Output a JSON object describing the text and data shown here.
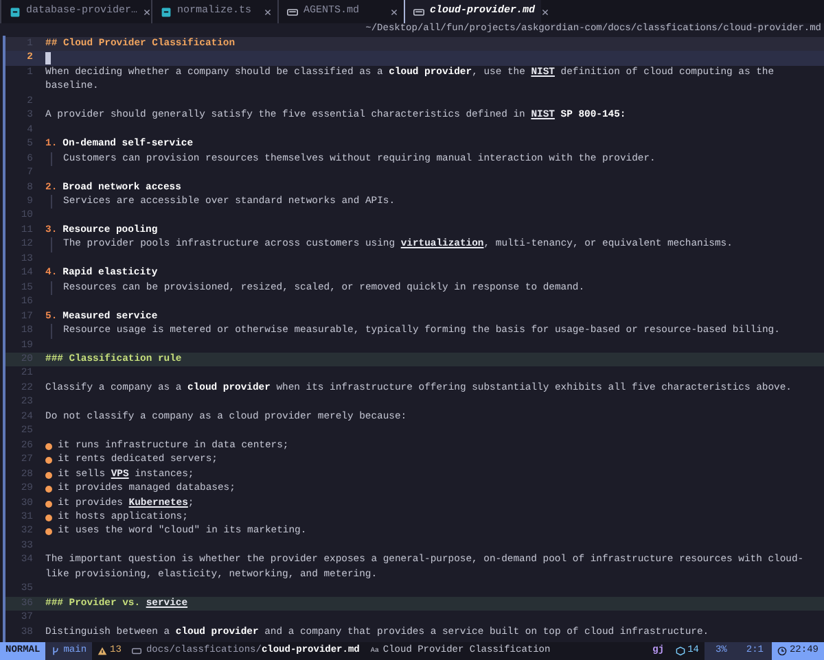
{
  "tabs": [
    {
      "label": "database-provider…",
      "kind": "script",
      "selected": false
    },
    {
      "label": "normalize.ts",
      "kind": "script",
      "selected": false
    },
    {
      "label": "AGENTS.md",
      "kind": "markdown",
      "selected": false
    },
    {
      "label": "cloud-provider.md",
      "kind": "markdown",
      "selected": true
    }
  ],
  "path": "~/Desktop/all/fun/projects/askgordian-com/docs/classfications/cloud-provider.md",
  "lines": [
    {
      "number": "1",
      "kind": "h2",
      "segments": [
        {
          "text": "## Cloud Provider Classification"
        }
      ]
    },
    {
      "number": "2",
      "kind": "cursor"
    },
    {
      "number": "1",
      "kind": "text",
      "segments": [
        {
          "text": "When deciding whether a company should be classified as a "
        },
        {
          "text": "cloud provider",
          "kind": "bold"
        },
        {
          "text": ", use the "
        },
        {
          "text": "NIST",
          "kind": "link"
        },
        {
          "text": " definition of cloud computing as the baseline."
        }
      ]
    },
    {
      "number": "2",
      "kind": "blank"
    },
    {
      "number": "3",
      "kind": "text",
      "segments": [
        {
          "text": "A provider should generally satisfy the five essential characteristics defined in "
        },
        {
          "text": "NIST",
          "kind": "link"
        },
        {
          "text": " SP 800-145:",
          "kind": "bold"
        }
      ]
    },
    {
      "number": "4",
      "kind": "blank"
    },
    {
      "number": "5",
      "kind": "numbered",
      "marker": "1.",
      "segments": [
        {
          "text": "On-demand self-service"
        }
      ]
    },
    {
      "number": "6",
      "kind": "detail",
      "segments": [
        {
          "text": "Customers can provision resources themselves without requiring manual interaction with the provider."
        }
      ]
    },
    {
      "number": "7",
      "kind": "blank"
    },
    {
      "number": "8",
      "kind": "numbered",
      "marker": "2.",
      "segments": [
        {
          "text": "Broad network access"
        }
      ]
    },
    {
      "number": "9",
      "kind": "detail",
      "segments": [
        {
          "text": "Services are accessible over standard networks and APIs."
        }
      ]
    },
    {
      "number": "10",
      "kind": "blank"
    },
    {
      "number": "11",
      "kind": "numbered",
      "marker": "3.",
      "segments": [
        {
          "text": "Resource pooling"
        }
      ]
    },
    {
      "number": "12",
      "kind": "detail",
      "segments": [
        {
          "text": "The provider pools infrastructure across customers using "
        },
        {
          "text": "virtualization",
          "kind": "link"
        },
        {
          "text": ", multi-tenancy, or equivalent mechanisms."
        }
      ]
    },
    {
      "number": "13",
      "kind": "blank"
    },
    {
      "number": "14",
      "kind": "numbered",
      "marker": "4.",
      "segments": [
        {
          "text": "Rapid elasticity"
        }
      ]
    },
    {
      "number": "15",
      "kind": "detail",
      "segments": [
        {
          "text": "Resources can be provisioned, resized, scaled, or removed quickly in response to demand."
        }
      ]
    },
    {
      "number": "16",
      "kind": "blank"
    },
    {
      "number": "17",
      "kind": "numbered",
      "marker": "5.",
      "segments": [
        {
          "text": "Measured service"
        }
      ]
    },
    {
      "number": "18",
      "kind": "detail",
      "segments": [
        {
          "text": "Resource usage is metered or otherwise measurable, typically forming the basis for usage-based or resource-based billing."
        }
      ]
    },
    {
      "number": "19",
      "kind": "blank"
    },
    {
      "number": "20",
      "kind": "h3",
      "segments": [
        {
          "text": "### Classification rule"
        }
      ]
    },
    {
      "number": "21",
      "kind": "blank"
    },
    {
      "number": "22",
      "kind": "text",
      "segments": [
        {
          "text": "Classify a company as a "
        },
        {
          "text": "cloud provider",
          "kind": "bold"
        },
        {
          "text": " when its infrastructure offering substantially exhibits all five characteristics above."
        }
      ]
    },
    {
      "number": "23",
      "kind": "blank"
    },
    {
      "number": "24",
      "kind": "text",
      "segments": [
        {
          "text": "Do not classify a company as a cloud provider merely because:"
        }
      ]
    },
    {
      "number": "25",
      "kind": "blank"
    },
    {
      "number": "26",
      "kind": "bullet",
      "segments": [
        {
          "text": "it runs infrastructure in data centers;"
        }
      ]
    },
    {
      "number": "27",
      "kind": "bullet",
      "segments": [
        {
          "text": "it rents dedicated servers;"
        }
      ]
    },
    {
      "number": "28",
      "kind": "bullet",
      "segments": [
        {
          "text": "it sells "
        },
        {
          "text": "VPS",
          "kind": "link"
        },
        {
          "text": " instances;"
        }
      ]
    },
    {
      "number": "29",
      "kind": "bullet",
      "segments": [
        {
          "text": "it provides managed databases;"
        }
      ]
    },
    {
      "number": "30",
      "kind": "bullet",
      "segments": [
        {
          "text": "it provides "
        },
        {
          "text": "Kubernetes",
          "kind": "link"
        },
        {
          "text": ";"
        }
      ]
    },
    {
      "number": "31",
      "kind": "bullet",
      "segments": [
        {
          "text": "it hosts applications;"
        }
      ]
    },
    {
      "number": "32",
      "kind": "bullet",
      "segments": [
        {
          "text": "it uses the word \"cloud\" in its marketing."
        }
      ]
    },
    {
      "number": "33",
      "kind": "blank"
    },
    {
      "number": "34",
      "kind": "text",
      "segments": [
        {
          "text": "The important question is whether the provider exposes a general-purpose, on-demand pool of infrastructure resources with cloud-like provisioning, elasticity, networking, and metering."
        }
      ]
    },
    {
      "number": "35",
      "kind": "blank"
    },
    {
      "number": "36",
      "kind": "h3",
      "segments": [
        {
          "text": "### Provider vs. "
        },
        {
          "text": "service",
          "kind": "link"
        }
      ]
    },
    {
      "number": "37",
      "kind": "blank"
    },
    {
      "number": "38",
      "kind": "text",
      "segments": [
        {
          "text": "Distinguish between a "
        },
        {
          "text": "cloud provider",
          "kind": "bold"
        },
        {
          "text": " and a company that provides a service built on top of cloud infrastructure."
        }
      ]
    }
  ],
  "status_bar": {
    "mode": "NORMAL",
    "branch": "main",
    "warnings": "13",
    "file_dir": "docs/classfications/",
    "file_name": "cloud-provider.md",
    "symbol_icon": "Aa",
    "symbol": "Cloud Provider Classification",
    "pending_keys": "gj",
    "count": "14",
    "progress": "3%",
    "position": "2:1",
    "time": "22:49"
  }
}
